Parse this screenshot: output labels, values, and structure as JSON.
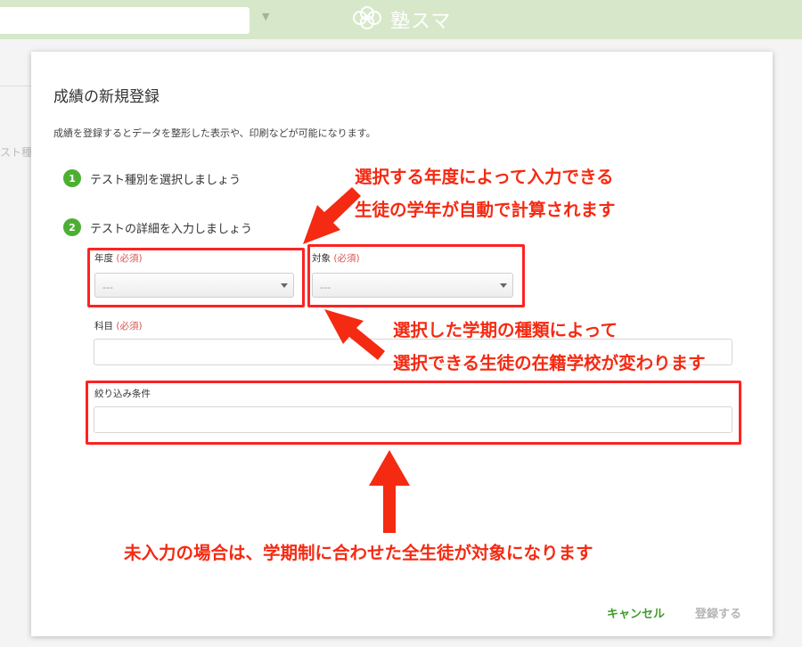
{
  "header": {
    "brand_name": "塾スマ"
  },
  "background": {
    "tab_fragment": "スト種"
  },
  "modal": {
    "title": "成績の新規登録",
    "description": "成績を登録するとデータを整形した表示や、印刷などが可能になります。",
    "steps": [
      {
        "number": "1",
        "label": "テスト種別を選択しましょう"
      },
      {
        "number": "2",
        "label": "テストの詳細を入力しましょう"
      }
    ],
    "fields": {
      "year": {
        "label": "年度",
        "required": "(必須)",
        "value": "---"
      },
      "target": {
        "label": "対象",
        "required": "(必須)",
        "value": "---"
      },
      "subject": {
        "label": "科目",
        "required": "(必須)",
        "value": ""
      },
      "filter": {
        "label": "絞り込み条件",
        "value": ""
      }
    },
    "buttons": {
      "cancel": "キャンセル",
      "submit": "登録する"
    }
  },
  "annotations": {
    "year_note_line1": "選択する年度によって入力できる",
    "year_note_line2": "生徒の学年が自動で計算されます",
    "target_note_line1": "選択した学期の種類によって",
    "target_note_line2": "選択できる生徒の在籍学校が変わります",
    "filter_note": "未入力の場合は、学期制に合わせた全生徒が対象になります"
  },
  "colors": {
    "accent_green": "#4caf32",
    "annotation_red": "#f42a12",
    "header_green": "#d6e8c9"
  }
}
